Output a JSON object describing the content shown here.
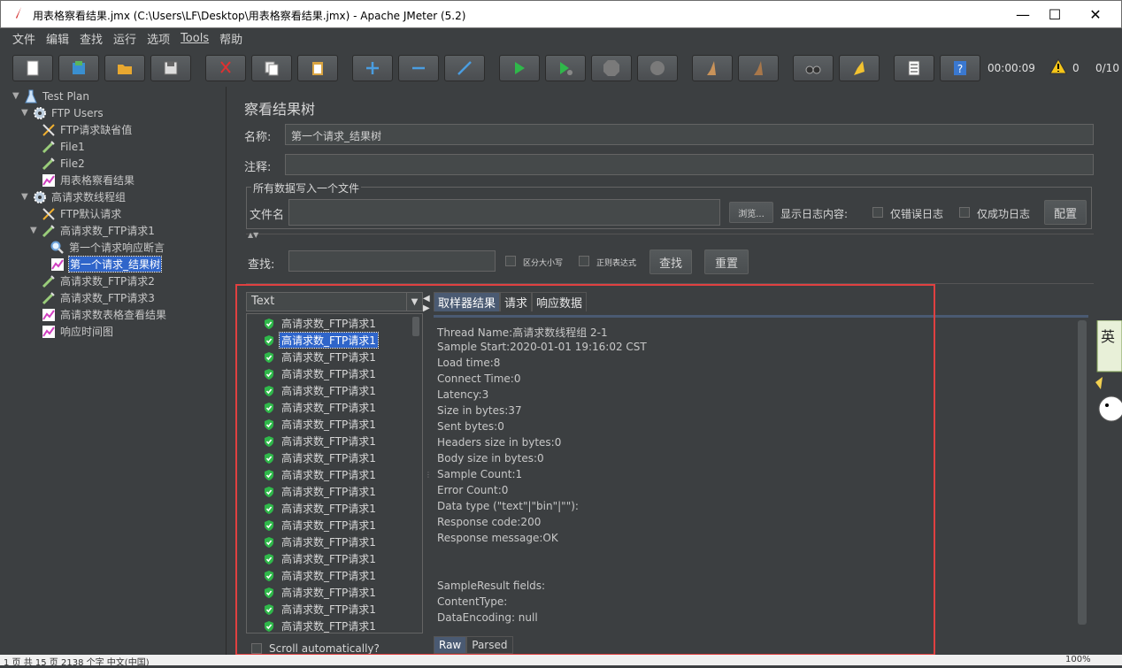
{
  "window": {
    "title": "用表格察看结果.jmx (C:\\Users\\LF\\Desktop\\用表格察看结果.jmx) - Apache JMeter (5.2)"
  },
  "menu": [
    "文件",
    "编辑",
    "查找",
    "运行",
    "选项",
    "Tools",
    "帮助"
  ],
  "toolbar": {
    "timer": "00:00:09",
    "warnings": "0",
    "threads": "0/10"
  },
  "tree": [
    {
      "label": "Test Plan",
      "depth": 0,
      "icon": "flask-icon",
      "toggle": "▼"
    },
    {
      "label": "FTP Users",
      "depth": 1,
      "icon": "gear-icon",
      "toggle": "▼"
    },
    {
      "label": "FTP请求缺省值",
      "depth": 2,
      "icon": "wrench-icon",
      "toggle": ""
    },
    {
      "label": "File1",
      "depth": 2,
      "icon": "pipette-icon",
      "toggle": ""
    },
    {
      "label": "File2",
      "depth": 2,
      "icon": "pipette-icon",
      "toggle": ""
    },
    {
      "label": "用表格察看结果",
      "depth": 2,
      "icon": "graph-icon",
      "toggle": ""
    },
    {
      "label": "高请求数线程组",
      "depth": 1,
      "icon": "gear-icon",
      "toggle": "▼"
    },
    {
      "label": "FTP默认请求",
      "depth": 2,
      "icon": "wrench-icon",
      "toggle": ""
    },
    {
      "label": "高请求数_FTP请求1",
      "depth": 2,
      "icon": "pipette-icon",
      "toggle": "▼"
    },
    {
      "label": "第一个请求响应断言",
      "depth": 3,
      "icon": "magnifier-icon",
      "toggle": ""
    },
    {
      "label": "第一个请求_结果树",
      "depth": 3,
      "icon": "graph-icon",
      "toggle": "",
      "selected": true
    },
    {
      "label": "高请求数_FTP请求2",
      "depth": 2,
      "icon": "pipette-icon",
      "toggle": ""
    },
    {
      "label": "高请求数_FTP请求3",
      "depth": 2,
      "icon": "pipette-icon",
      "toggle": ""
    },
    {
      "label": "高请求数表格查看结果",
      "depth": 2,
      "icon": "graph-icon",
      "toggle": ""
    },
    {
      "label": "响应时间图",
      "depth": 2,
      "icon": "graph-icon",
      "toggle": ""
    }
  ],
  "panel": {
    "title": "察看结果树",
    "name_label": "名称:",
    "name_value": "第一个请求_结果树",
    "comment_label": "注释:",
    "comment_value": "",
    "file_section": "所有数据写入一个文件",
    "filename_label": "文件名",
    "browse_button": "浏览...",
    "log_label": "显示日志内容:",
    "errors_only": "仅错误日志",
    "success_only": "仅成功日志",
    "configure_button": "配置",
    "search_label": "查找:",
    "case_sensitive": "区分大小写",
    "regex": "正则表达式",
    "search_button": "查找",
    "reset_button": "重置"
  },
  "results": {
    "view_mode": "Text",
    "items": [
      "高请求数_FTP请求1",
      "高请求数_FTP请求1",
      "高请求数_FTP请求1",
      "高请求数_FTP请求1",
      "高请求数_FTP请求1",
      "高请求数_FTP请求1",
      "高请求数_FTP请求1",
      "高请求数_FTP请求1",
      "高请求数_FTP请求1",
      "高请求数_FTP请求1",
      "高请求数_FTP请求1",
      "高请求数_FTP请求1",
      "高请求数_FTP请求1",
      "高请求数_FTP请求1",
      "高请求数_FTP请求1",
      "高请求数_FTP请求1",
      "高请求数_FTP请求1",
      "高请求数_FTP请求1",
      "高请求数_FTP请求1"
    ],
    "selected_index": 1,
    "auto_scroll": "Scroll automatically?"
  },
  "detail": {
    "tabs": [
      "取样器结果",
      "请求",
      "响应数据"
    ],
    "lines": [
      "Thread Name:高请求数线程组 2-1",
      "Sample Start:2020-01-01 19:16:02 CST",
      "Load time:8",
      "Connect Time:0",
      "Latency:3",
      "Size in bytes:37",
      "Sent bytes:0",
      "Headers size in bytes:0",
      "Body size in bytes:0",
      "Sample Count:1",
      "Error Count:0",
      "Data type (\"text\"|\"bin\"|\"\"):",
      "Response code:200",
      "Response message:OK",
      "",
      "",
      "SampleResult fields:",
      "ContentType:",
      "DataEncoding: null"
    ],
    "view_tabs": [
      "Raw",
      "Parsed"
    ]
  },
  "status": {
    "left": "1 页   共 15 页   2138 个字   中文(中国)",
    "zoom": "100%"
  }
}
